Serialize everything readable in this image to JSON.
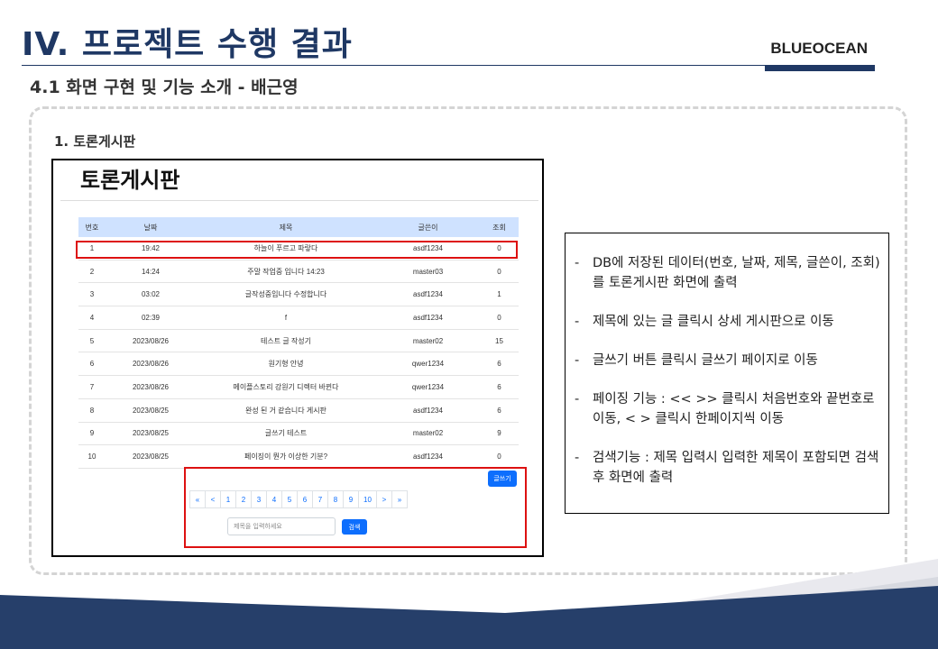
{
  "slide": {
    "title": "IV. 프로젝트 수행 결과",
    "brand": "BLUEOCEAN",
    "subtitle": "4.1 화면 구현 및 기능 소개 - 배근영",
    "section": "1. 토론게시판"
  },
  "board": {
    "title": "토론게시판",
    "columns": [
      "번호",
      "날짜",
      "제목",
      "글쓴이",
      "조회"
    ],
    "rows": [
      [
        "1",
        "19:42",
        "하늘이 푸르고 파랗다",
        "asdf1234",
        "0"
      ],
      [
        "2",
        "14:24",
        "주말 작업중 입니다 14:23",
        "master03",
        "0"
      ],
      [
        "3",
        "03:02",
        "글작성중입니다 수정합니다",
        "asdf1234",
        "1"
      ],
      [
        "4",
        "02:39",
        "f",
        "asdf1234",
        "0"
      ],
      [
        "5",
        "2023/08/26",
        "테스트 글 작성기",
        "master02",
        "15"
      ],
      [
        "6",
        "2023/08/26",
        "원기형 안녕",
        "qwer1234",
        "6"
      ],
      [
        "7",
        "2023/08/26",
        "메이플스토리 강원기 디렉터 바뀐다",
        "qwer1234",
        "6"
      ],
      [
        "8",
        "2023/08/25",
        "완성 된 거 같습니다 게시판",
        "asdf1234",
        "6"
      ],
      [
        "9",
        "2023/08/25",
        "글쓰기 테스트",
        "master02",
        "9"
      ],
      [
        "10",
        "2023/08/25",
        "페이징이 뭔가 이상한 기분?",
        "asdf1234",
        "0"
      ]
    ],
    "write_button": "글쓰기",
    "pagination": [
      "«",
      "<",
      "1",
      "2",
      "3",
      "4",
      "5",
      "6",
      "7",
      "8",
      "9",
      "10",
      ">",
      "»"
    ],
    "search_placeholder": "제목을 입력하세요",
    "search_button": "검색"
  },
  "description": {
    "items": [
      "DB에 저장된 데이터(번호, 날짜, 제목, 글쓴이, 조회)를 토론게시판 화면에 출력",
      "제목에 있는 글 클릭시 상세 게시판으로 이동",
      "글쓰기 버튼 클릭시 글쓰기 페이지로 이동",
      "페이징 기능 : << >> 클릭시 처음번호와 끝번호로 이동, < > 클릭시 한페이지씩 이동",
      "검색기능 : 제목 입력시 입력한 제목이 포함되면 검색 후 화면에 출력"
    ]
  },
  "colors": {
    "title_navy": "#1f3864",
    "header_blue": "#cfe2ff",
    "button_blue": "#0d6efd",
    "highlight_red": "#dd1111",
    "footer_navy": "#263f6a"
  }
}
